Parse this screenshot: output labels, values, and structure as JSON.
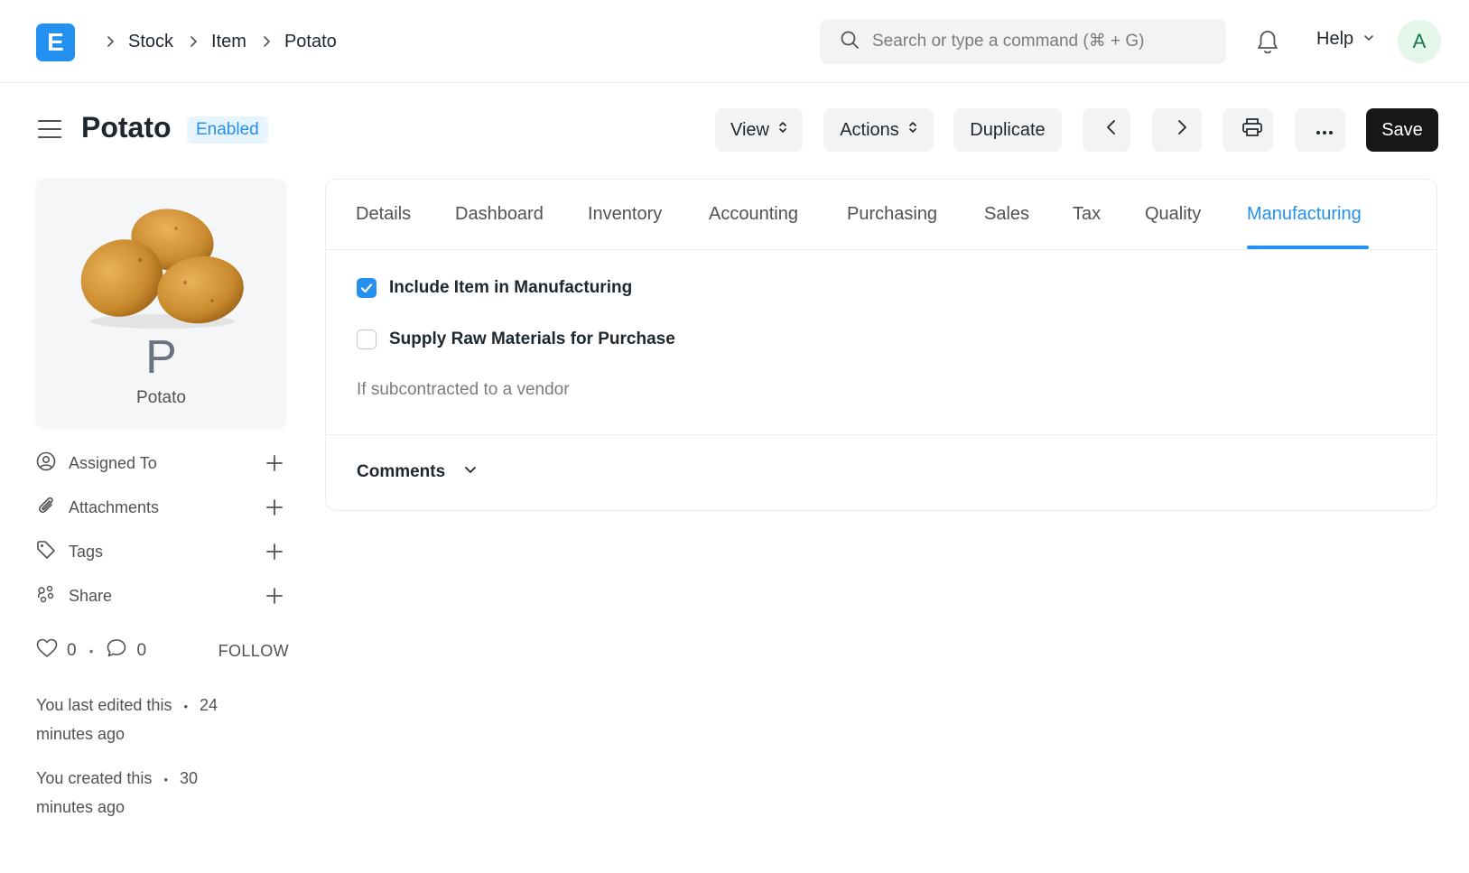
{
  "navbar": {
    "logo_letter": "E",
    "breadcrumbs": [
      "Stock",
      "Item",
      "Potato"
    ],
    "search_placeholder": "Search or type a command (⌘ + G)",
    "help_label": "Help",
    "avatar_initial": "A"
  },
  "page": {
    "title": "Potato",
    "status": "Enabled",
    "buttons": {
      "view": "View",
      "actions": "Actions",
      "duplicate": "Duplicate",
      "save": "Save"
    }
  },
  "sidebar": {
    "image_letter": "P",
    "image_caption": "Potato",
    "items": [
      {
        "label": "Assigned To",
        "icon": "user-circle-icon"
      },
      {
        "label": "Attachments",
        "icon": "paperclip-icon"
      },
      {
        "label": "Tags",
        "icon": "tag-icon"
      },
      {
        "label": "Share",
        "icon": "share-icon"
      }
    ],
    "likes_count": "0",
    "comments_count": "0",
    "follow_label": "FOLLOW",
    "activity": [
      {
        "text": "You last edited this",
        "time": "24 minutes ago"
      },
      {
        "text": "You created this",
        "time": "30 minutes ago"
      }
    ]
  },
  "tabs": [
    "Details",
    "Dashboard",
    "Inventory",
    "Accounting",
    "Purchasing",
    "Sales",
    "Tax",
    "Quality",
    "Manufacturing"
  ],
  "active_tab": "Manufacturing",
  "manufacturing": {
    "include_label": "Include Item in Manufacturing",
    "include_checked": true,
    "supply_label": "Supply Raw Materials for Purchase",
    "supply_checked": false,
    "supply_help": "If subcontracted to a vendor"
  },
  "comments_label": "Comments",
  "colors": {
    "accent": "#2490ef",
    "save_bg": "#171717",
    "avatar_bg": "#e4f5e9",
    "avatar_fg": "#16794c"
  }
}
